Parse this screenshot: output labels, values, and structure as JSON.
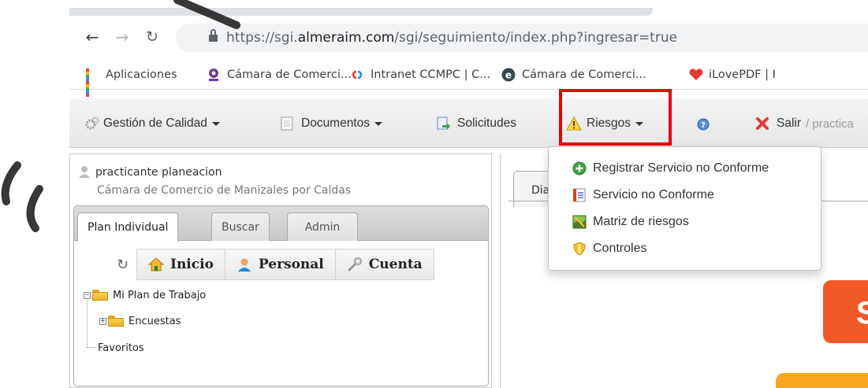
{
  "browser": {
    "back_icon": "arrow-left-icon",
    "forward_icon": "arrow-right-icon",
    "reload_icon": "reload-icon",
    "url_prefix": "https://sgi.",
    "url_domain": "almeraim.com",
    "url_path": "/sgi/seguimiento/index.php?ingresar=true"
  },
  "bookmarks": [
    {
      "label": "Aplicaciones",
      "icon": "apps-grid-icon"
    },
    {
      "label": "Cámara de Comerci...",
      "icon": "chamber-logo-icon"
    },
    {
      "label": "Intranet CCMPC | C...",
      "icon": "intranet-logo-icon"
    },
    {
      "label": "Cámara de Comerci...",
      "icon": "e-logo-icon"
    },
    {
      "label": "iLovePDF | I",
      "icon": "heart-icon"
    }
  ],
  "toolbar": {
    "items": [
      {
        "label": "Gestión de Calidad",
        "icon": "gears-icon",
        "has_caret": true
      },
      {
        "label": "Documentos",
        "icon": "document-icon",
        "has_caret": true
      },
      {
        "label": "Solicitudes",
        "icon": "request-icon",
        "has_caret": false
      },
      {
        "label": "Riesgos",
        "icon": "warning-icon",
        "has_caret": true
      },
      {
        "label": "",
        "icon": "help-icon",
        "has_caret": false
      },
      {
        "label": "Salir",
        "icon": "close-icon",
        "has_caret": false
      }
    ],
    "path_text": "/ practica",
    "highlight_color": "#e8000b"
  },
  "user": {
    "name": "practicante planeacion",
    "organization": "Cámara de Comercio de Manizales por Caldas"
  },
  "left_tabs": [
    {
      "label": "Plan Individual",
      "active": true
    },
    {
      "label": "Buscar",
      "active": false
    },
    {
      "label": "Admin",
      "active": false
    }
  ],
  "left_buttons": [
    {
      "label": "Inicio",
      "icon": "home-icon"
    },
    {
      "label": "Personal",
      "icon": "person-icon"
    },
    {
      "label": "Cuenta",
      "icon": "wrench-icon"
    }
  ],
  "tree": {
    "root": "Mi Plan de Trabajo",
    "child": "Encuestas",
    "favorites": "Favoritos",
    "root_toggle": "−",
    "child_toggle": "+"
  },
  "right_panel": {
    "tab_label": "Dia"
  },
  "dropdown": {
    "items": [
      {
        "label": "Registrar Servicio no Conforme",
        "icon": "add-circle-icon"
      },
      {
        "label": "Servicio no Conforme",
        "icon": "notebook-icon"
      },
      {
        "label": "Matriz de riesgos",
        "icon": "map-icon"
      },
      {
        "label": "Controles",
        "icon": "shield-icon"
      }
    ]
  },
  "orange_banner_letter": "S"
}
